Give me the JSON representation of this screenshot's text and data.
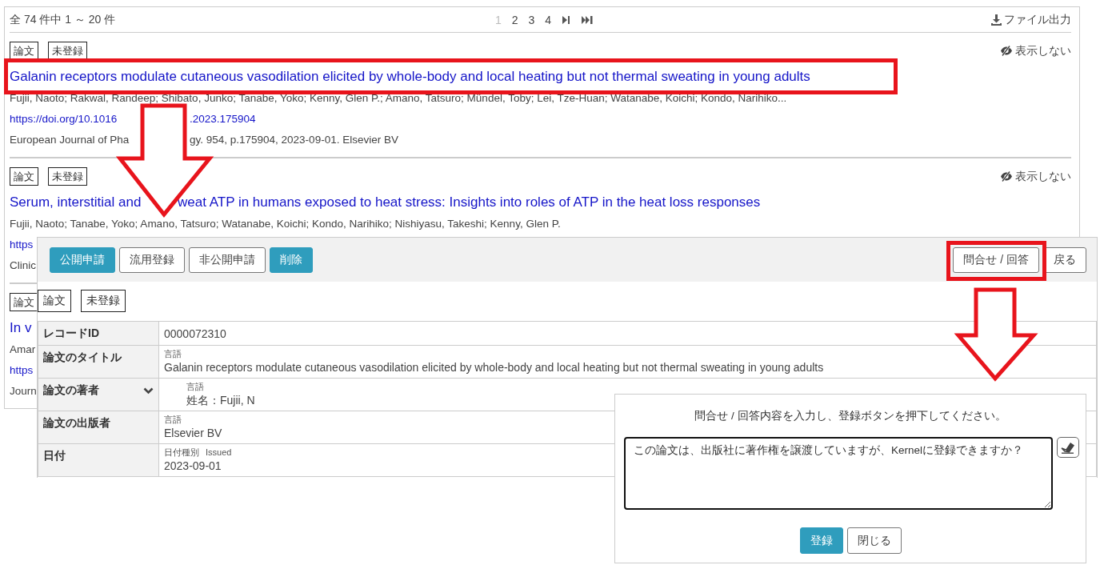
{
  "results": {
    "summary": "全 74 件中 1 ～ 20 件",
    "pages": [
      {
        "label": "1",
        "selected": true
      },
      {
        "label": "2",
        "selected": false
      },
      {
        "label": "3",
        "selected": false
      },
      {
        "label": "4",
        "selected": false
      }
    ],
    "export_label": "ファイル出力",
    "items": [
      {
        "tags": [
          "論文",
          "未登録"
        ],
        "hide_label": "表示しない",
        "title": [
          "Galanin receptors modulate cutaneous vasodilation elicited by whole-body and local heating but not thermal sweating in young adults"
        ],
        "authors": [
          "Fujii, Naoto; Rakwal, Randeep; Shibato, Junko; Tanabe, Yoko; Kenny, Glen P.; Amano, Tatsuro; Mündel, Toby; Lei, Tze-Huan; Watanabe, Koichi; Kondo, Narihiko..."
        ],
        "link": [
          "https://doi.org/10.1016",
          ".2023.175904"
        ],
        "source": [
          "European Journal of Pha",
          "gy. 954, p.175904, 2023-09-01. Elsevier BV"
        ]
      },
      {
        "tags": [
          "論文",
          "未登録"
        ],
        "hide_label": "表示しない",
        "title": [
          "Serum, interstitial and",
          "weat ATP in humans exposed to heat stress: Insights into roles of ATP in the heat loss responses"
        ],
        "authors": [
          "Fujii, Naoto; Tanabe, Yoko; Amano, Tatsuro; Watanabe, Koichi; Kondo, Narihiko; Nishiyasu, Takeshi; Kenny, Glen P."
        ],
        "link": [
          "https"
        ],
        "source": [
          "Clinic"
        ]
      },
      {
        "tags": [
          "論文"
        ],
        "title": [
          "In v"
        ],
        "authors": [
          "Amar"
        ],
        "link": [
          "https"
        ],
        "source": [
          "Journ"
        ]
      }
    ]
  },
  "detail": {
    "toolbar_left": [
      {
        "label": "公開申請",
        "kind": "primary"
      },
      {
        "label": "流用登録",
        "kind": "default"
      },
      {
        "label": "非公開申請",
        "kind": "default"
      },
      {
        "label": "削除",
        "kind": "primary"
      }
    ],
    "toolbar_right": [
      {
        "label": "問合せ / 回答",
        "kind": "default"
      },
      {
        "label": "戻る",
        "kind": "default"
      }
    ],
    "tags": [
      "論文",
      "未登録"
    ],
    "fields": [
      {
        "kind": "plain",
        "label": "レコードID",
        "value": "0000072310"
      },
      {
        "kind": "captioned",
        "label": "論文のタイトル",
        "captions": [
          "言語"
        ],
        "value": "Galanin receptors modulate cutaneous vasodilation elicited by whole-body and local heating but not thermal sweating in young adults"
      },
      {
        "kind": "group",
        "label": "論文の著者",
        "captions": [
          "言語"
        ],
        "value": "姓名：Fujii, N"
      },
      {
        "kind": "captioned",
        "label": "論文の出版者",
        "captions": [
          "言語"
        ],
        "value": "Elsevier BV"
      },
      {
        "kind": "captioned",
        "label": "日付",
        "captions": [
          "日付種別",
          "Issued"
        ],
        "value": "2023-09-01"
      }
    ]
  },
  "dialog": {
    "message": "問合せ / 回答内容を入力し、登録ボタンを押下してください。",
    "text": "この論文は、出版社に著作権を譲渡していますが、Kernelに登録できますか？",
    "buttons": [
      {
        "label": "登録",
        "kind": "primary"
      },
      {
        "label": "閉じる",
        "kind": "default"
      }
    ]
  },
  "annotations": {
    "title_callout": true,
    "inquiry_button_callout": true
  }
}
